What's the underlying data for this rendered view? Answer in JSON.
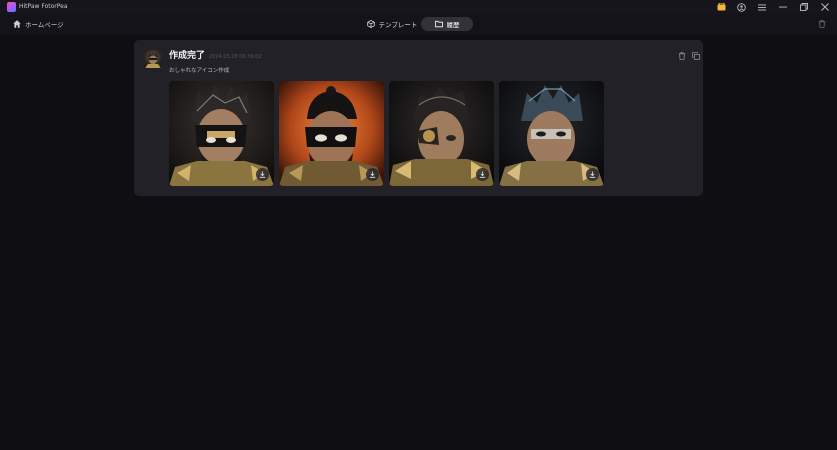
{
  "app": {
    "title": "HitPaw FotorPea"
  },
  "nav": {
    "home_label": "ホームページ",
    "tabs": [
      {
        "label": "テンプレート",
        "icon": "cube-icon",
        "active": false
      },
      {
        "label": "履歴",
        "icon": "folder-icon",
        "active": true
      }
    ]
  },
  "history": {
    "title": "作成完了",
    "timestamp": "2024.03.28 06:39:02",
    "subtitle": "おしゃれなアイコン作成",
    "images": [
      {
        "name": "warrior-portrait-1",
        "background": "dark"
      },
      {
        "name": "warrior-portrait-2",
        "background": "orange"
      },
      {
        "name": "warrior-portrait-3",
        "background": "dark"
      },
      {
        "name": "warrior-portrait-4",
        "background": "dark"
      }
    ]
  },
  "colors": {
    "background": "#0f0e13",
    "card": "#212127",
    "active_tab": "#33323b"
  }
}
